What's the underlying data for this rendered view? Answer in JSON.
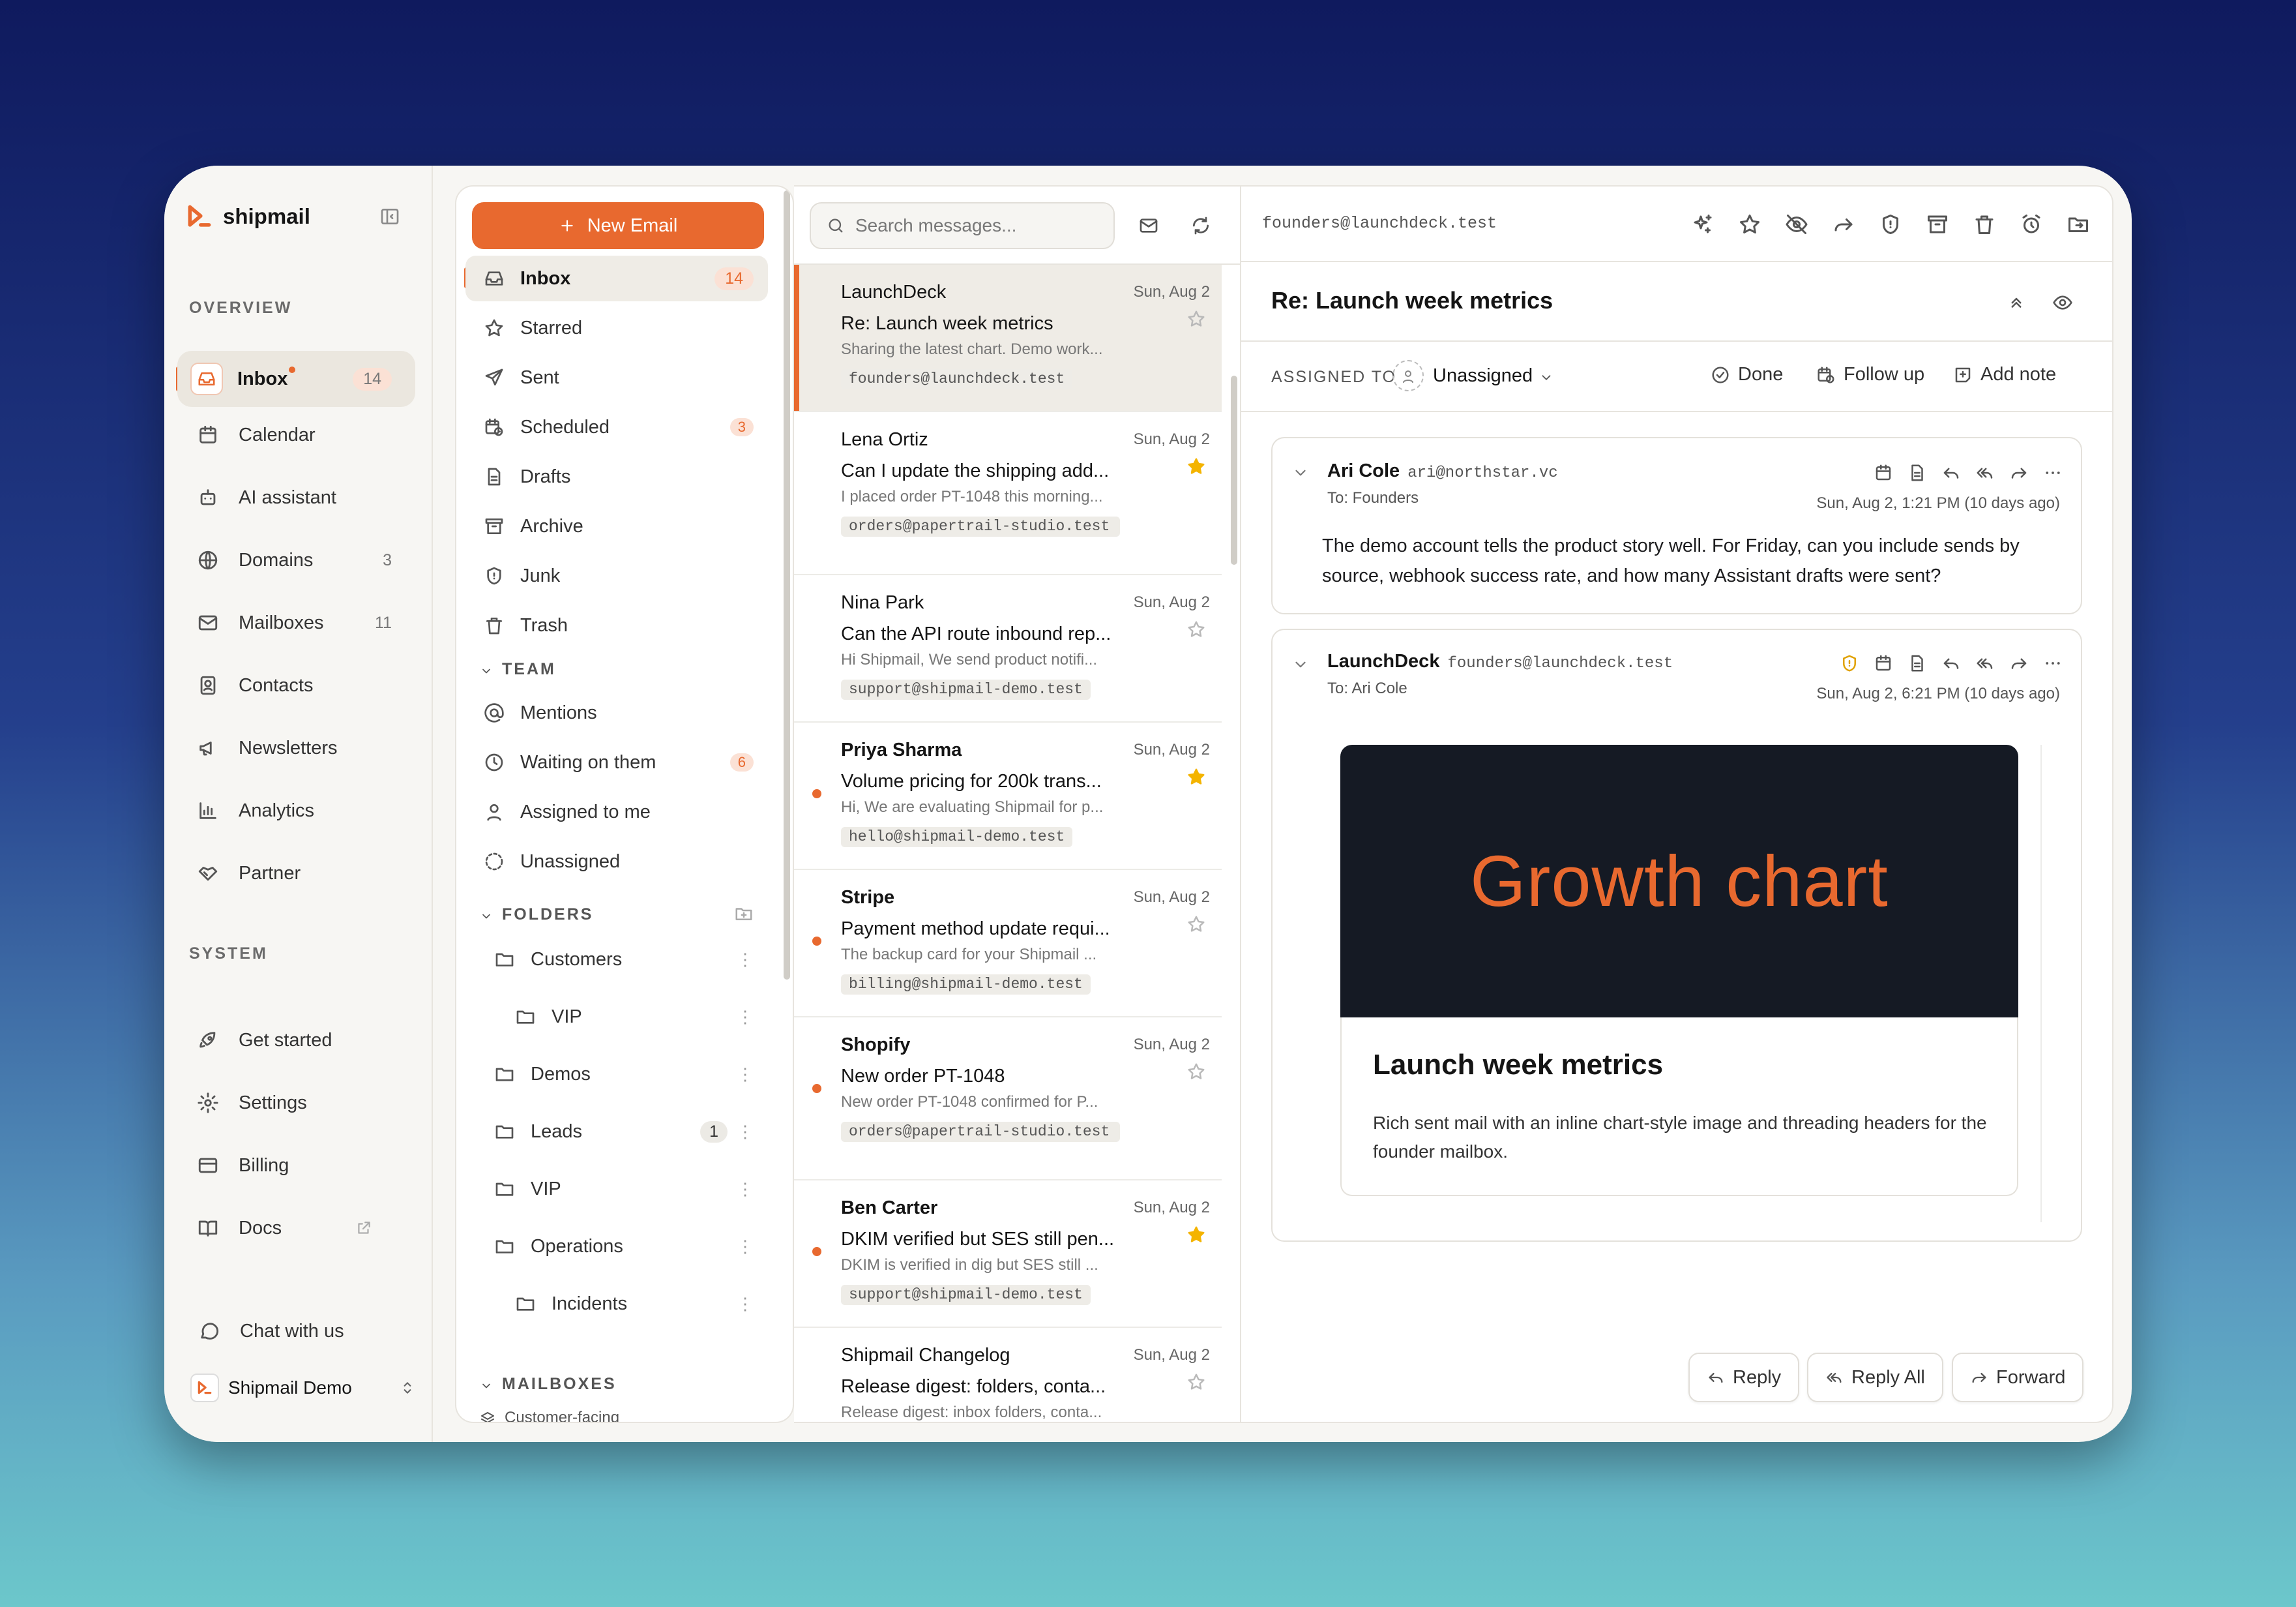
{
  "app": {
    "name": "shipmail"
  },
  "nav": {
    "overview_label": "OVERVIEW",
    "system_label": "SYSTEM",
    "overview": [
      {
        "label": "Inbox",
        "count": "14",
        "icon": "inbox-icon"
      },
      {
        "label": "Calendar",
        "count": "",
        "icon": "calendar-icon"
      },
      {
        "label": "AI assistant",
        "count": "",
        "icon": "bot-icon"
      },
      {
        "label": "Domains",
        "count": "3",
        "icon": "globe-icon"
      },
      {
        "label": "Mailboxes",
        "count": "11",
        "icon": "mail-icon"
      },
      {
        "label": "Contacts",
        "count": "",
        "icon": "contact-icon"
      },
      {
        "label": "Newsletters",
        "count": "",
        "icon": "megaphone-icon"
      },
      {
        "label": "Analytics",
        "count": "",
        "icon": "chart-icon"
      },
      {
        "label": "Partner",
        "count": "",
        "icon": "handshake-icon"
      }
    ],
    "system": [
      {
        "label": "Get started",
        "icon": "rocket-icon"
      },
      {
        "label": "Settings",
        "icon": "gear-icon"
      },
      {
        "label": "Billing",
        "icon": "card-icon"
      },
      {
        "label": "Docs",
        "icon": "book-icon"
      }
    ],
    "chat_label": "Chat with us",
    "account_name": "Shipmail Demo"
  },
  "folders": {
    "new_email": "New Email",
    "main": [
      {
        "label": "Inbox",
        "count": "14",
        "icon": "inbox-icon"
      },
      {
        "label": "Starred",
        "count": "",
        "icon": "star-icon"
      },
      {
        "label": "Sent",
        "count": "",
        "icon": "send-icon"
      },
      {
        "label": "Scheduled",
        "count": "3",
        "icon": "clock-calendar-icon"
      },
      {
        "label": "Drafts",
        "count": "",
        "icon": "file-icon"
      },
      {
        "label": "Archive",
        "count": "",
        "icon": "archive-icon"
      },
      {
        "label": "Junk",
        "count": "",
        "icon": "shield-icon"
      },
      {
        "label": "Trash",
        "count": "",
        "icon": "trash-icon"
      }
    ],
    "team_label": "TEAM",
    "team": [
      {
        "label": "Mentions",
        "count": "",
        "icon": "at-icon"
      },
      {
        "label": "Waiting on them",
        "count": "6",
        "icon": "clock-icon"
      },
      {
        "label": "Assigned to me",
        "count": "",
        "icon": "user-icon"
      },
      {
        "label": "Unassigned",
        "count": "",
        "icon": "dashed-circle-icon"
      }
    ],
    "folders_label": "FOLDERS",
    "custom": [
      {
        "label": "Customers",
        "count": ""
      },
      {
        "label": "VIP",
        "count": ""
      },
      {
        "label": "Demos",
        "count": ""
      },
      {
        "label": "Leads",
        "count": "1"
      },
      {
        "label": "VIP",
        "count": ""
      },
      {
        "label": "Operations",
        "count": ""
      },
      {
        "label": "Incidents",
        "count": ""
      }
    ],
    "mailboxes_label": "MAILBOXES",
    "mailbox_first": "Customer-facing"
  },
  "list": {
    "search_placeholder": "Search messages...",
    "messages": [
      {
        "from": "LaunchDeck",
        "date": "Sun, Aug 2",
        "subject": "Re: Launch week metrics",
        "preview": "Sharing the latest chart. Demo work...",
        "tag": "founders@launchdeck.test",
        "starred": false,
        "unread": false
      },
      {
        "from": "Lena Ortiz",
        "date": "Sun, Aug 2",
        "subject": "Can I update the shipping add...",
        "preview": "I placed order PT-1048 this morning...",
        "tag": "orders@papertrail-studio.test",
        "starred": true,
        "unread": false
      },
      {
        "from": "Nina Park",
        "date": "Sun, Aug 2",
        "subject": "Can the API route inbound rep...",
        "preview": "Hi Shipmail, We send product notifi...",
        "tag": "support@shipmail-demo.test",
        "starred": false,
        "unread": false
      },
      {
        "from": "Priya Sharma",
        "date": "Sun, Aug 2",
        "subject": "Volume pricing for 200k trans...",
        "preview": "Hi, We are evaluating Shipmail for p...",
        "tag": "hello@shipmail-demo.test",
        "starred": true,
        "unread": true
      },
      {
        "from": "Stripe",
        "date": "Sun, Aug 2",
        "subject": "Payment method update requi...",
        "preview": "The backup card for your Shipmail ...",
        "tag": "billing@shipmail-demo.test",
        "starred": false,
        "unread": true
      },
      {
        "from": "Shopify",
        "date": "Sun, Aug 2",
        "subject": "New order PT-1048",
        "preview": "New order PT-1048 confirmed for P...",
        "tag": "orders@papertrail-studio.test",
        "starred": false,
        "unread": true
      },
      {
        "from": "Ben Carter",
        "date": "Sun, Aug 2",
        "subject": "DKIM verified but SES still pen...",
        "preview": "DKIM is verified in dig but SES still ...",
        "tag": "support@shipmail-demo.test",
        "starred": true,
        "unread": true
      },
      {
        "from": "Shipmail Changelog",
        "date": "Sun, Aug 2",
        "subject": "Release digest: folders, conta...",
        "preview": "Release digest: inbox folders, conta...",
        "tag": "",
        "starred": false,
        "unread": false
      }
    ]
  },
  "reader": {
    "mailbox": "founders@launchdeck.test",
    "title": "Re: Launch week metrics",
    "assigned_label": "ASSIGNED TO",
    "assignee": "Unassigned",
    "done": "Done",
    "follow_up": "Follow up",
    "add_note": "Add note",
    "messages": [
      {
        "name": "Ari Cole",
        "email": "ari@northstar.vc",
        "to": "To: Founders",
        "date": "Sun, Aug 2, 1:21 PM (10 days ago)",
        "body": "The demo account tells the product story well. For Friday, can you include sends by source, webhook success rate, and how many Assistant drafts were sent?"
      },
      {
        "name": "LaunchDeck",
        "email": "founders@launchdeck.test",
        "to": "To: Ari Cole",
        "date": "Sun, Aug 2, 6:21 PM (10 days ago)",
        "banner": "Growth chart",
        "heading": "Launch week metrics",
        "body": "Rich sent mail with an inline chart-style image and threading headers for the founder mailbox."
      }
    ],
    "reply": "Reply",
    "reply_all": "Reply All",
    "forward": "Forward"
  },
  "colors": {
    "accent": "#e8692f",
    "star": "#f4b400"
  }
}
